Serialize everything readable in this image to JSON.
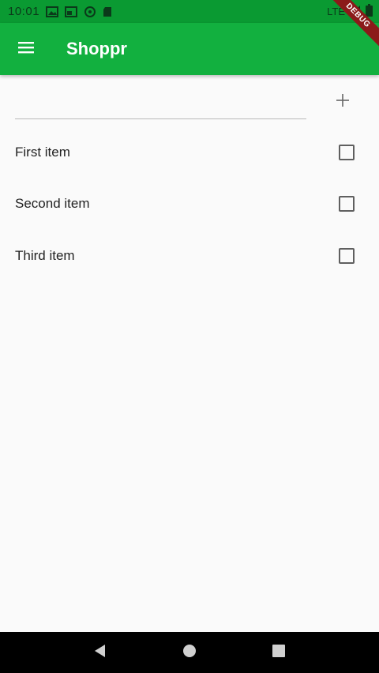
{
  "status_bar": {
    "time": "10:01",
    "network_label": "LTE",
    "icons": [
      "image-icon",
      "cast-icon",
      "sync-icon",
      "sd-card-icon",
      "signal-icon",
      "battery-icon"
    ]
  },
  "debug_banner": {
    "label": "DEBUG"
  },
  "app_bar": {
    "title": "Shoppr",
    "color": "#12b03f",
    "menu_icon": "menu-icon"
  },
  "new_item": {
    "value": "",
    "placeholder": "",
    "add_icon": "add-icon"
  },
  "items": [
    {
      "label": "First item",
      "checked": false
    },
    {
      "label": "Second item",
      "checked": false
    },
    {
      "label": "Third item",
      "checked": false
    }
  ],
  "nav_bar": {
    "buttons": [
      "back-icon",
      "home-icon",
      "recents-icon"
    ]
  }
}
